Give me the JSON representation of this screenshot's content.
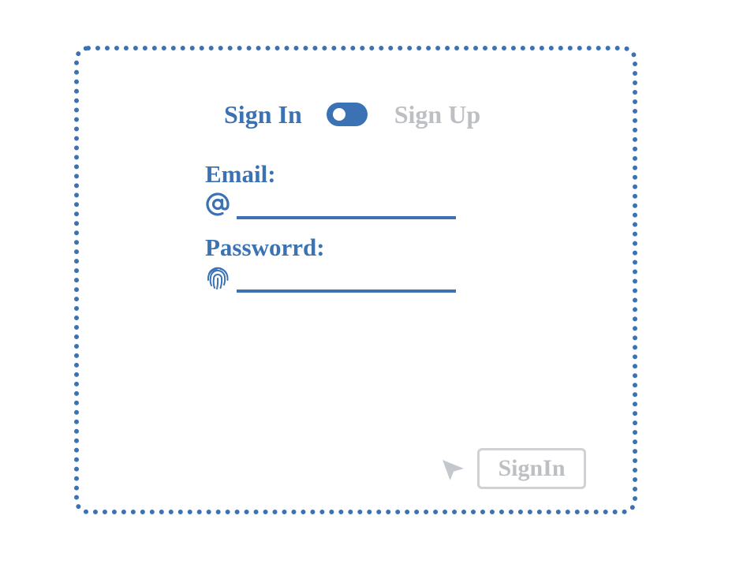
{
  "mode_switch": {
    "left_label": "Sign In",
    "right_label": "Sign Up",
    "selected": "Sign In"
  },
  "form": {
    "email": {
      "label": "Email:",
      "icon": "at-sign-icon",
      "value": ""
    },
    "password": {
      "label": "Passworrd:",
      "icon": "fingerprint-icon",
      "value": ""
    }
  },
  "submit": {
    "label": "SignIn",
    "cursor_icon": "mouse-pointer-icon"
  },
  "colors": {
    "accent": "#3b72b3",
    "muted_text": "#bcbfc3",
    "button_border": "#cfd1d4",
    "background": "#ffffff"
  }
}
